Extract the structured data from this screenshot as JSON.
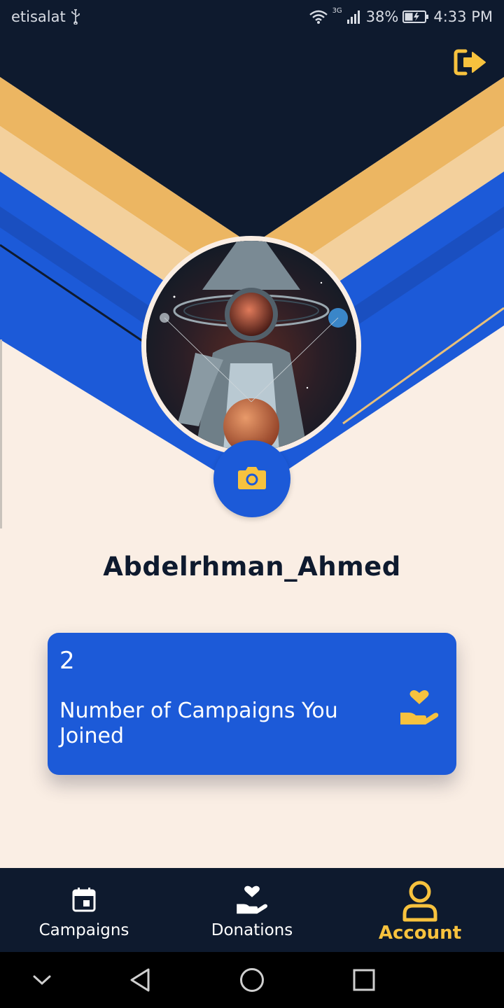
{
  "status_bar": {
    "carrier": "etisalat",
    "network_type": "3G",
    "battery": "38%",
    "time": "4:33 PM"
  },
  "header": {
    "logout_icon": "logout-icon"
  },
  "profile": {
    "avatar": "astronaut-illustration",
    "camera_icon": "camera-icon",
    "username": "Abdelrhman_Ahmed"
  },
  "stats": {
    "count": "2",
    "label": "Number of Campaigns You Joined",
    "icon": "hand-heart-icon"
  },
  "bottom_nav": {
    "items": [
      {
        "label": "Campaigns",
        "icon": "calendar-icon",
        "active": false
      },
      {
        "label": "Donations",
        "icon": "hand-heart-icon",
        "active": false
      },
      {
        "label": "Account",
        "icon": "user-icon",
        "active": true
      }
    ]
  },
  "system_nav": [
    "collapse-icon",
    "back-icon",
    "home-icon",
    "recents-icon"
  ],
  "colors": {
    "navy": "#0e1a2e",
    "blue": "#1c5ad8",
    "gold": "#f7c23e",
    "stripe_gold": "#ecb662",
    "stripe_peach": "#f3d09c",
    "cream": "#faeee4"
  }
}
